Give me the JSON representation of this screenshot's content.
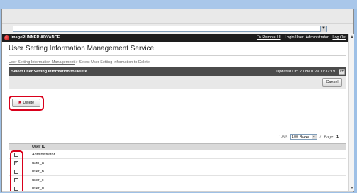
{
  "browser": {
    "address_value": "",
    "address_dropdown_icon": "chevron-down-icon"
  },
  "header": {
    "brand": "imageRUNNER ADVANCE",
    "links": {
      "remote_ui": "To Remote UI",
      "login_user": "Login User: Administrator",
      "logout": "Log Out"
    }
  },
  "page": {
    "title": "User Setting Information Management Service",
    "breadcrumb": {
      "parent": "User Setting Information Management",
      "separator": " > ",
      "current": "Select User Setting Information to Delete"
    }
  },
  "section": {
    "title": "Select User Setting Information to Delete",
    "updated": "Updated On: 2009/01/29 11:37:19",
    "refresh_icon": "refresh-icon"
  },
  "buttons": {
    "cancel": "Cancel",
    "delete": "Delete",
    "delete_icon": "x-icon"
  },
  "pager": {
    "range": "1-5/5",
    "rows_option": "100 Rows",
    "page_prefix": "/1 Page",
    "page_number": "1"
  },
  "table": {
    "column_header": "User ID",
    "rows": [
      {
        "user_id": "Administrator",
        "checked": false
      },
      {
        "user_id": "user_a",
        "checked": true
      },
      {
        "user_id": "user_b",
        "checked": false
      },
      {
        "user_id": "user_c",
        "checked": false
      },
      {
        "user_id": "user_d",
        "checked": false
      }
    ]
  },
  "colors": {
    "highlight": "#d9001b",
    "brand_bar": "#1d1d1d",
    "section_bar": "#4b4b4b",
    "delete_icon": "#c8102e"
  }
}
